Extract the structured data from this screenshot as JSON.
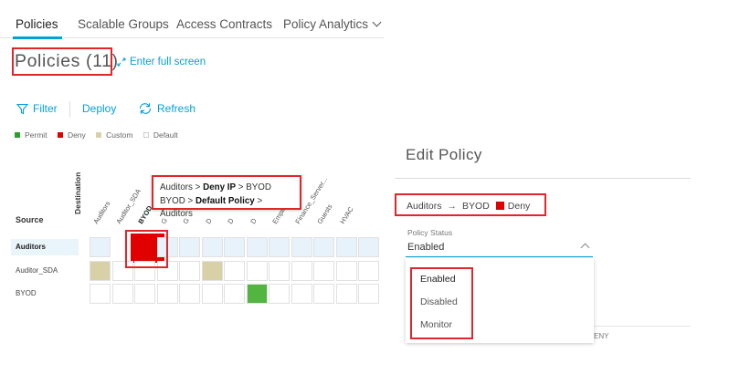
{
  "tabs": [
    {
      "label": "Policies"
    },
    {
      "label": "Scalable Groups"
    },
    {
      "label": "Access Contracts"
    },
    {
      "label": "Policy Analytics"
    }
  ],
  "page_title": "Policies (11)",
  "fullscreen_label": "Enter full screen",
  "toolbar": {
    "filter": "Filter",
    "deploy": "Deploy",
    "refresh": "Refresh"
  },
  "legend": [
    {
      "label": "Permit",
      "color": "#2ca02c"
    },
    {
      "label": "Deny",
      "color": "#e00000"
    },
    {
      "label": "Custom",
      "color": "#d8d0a6"
    },
    {
      "label": "Default",
      "color": "#ffffff"
    }
  ],
  "matrix": {
    "destination_label": "Destination",
    "source_label": "Source",
    "columns": [
      "Auditors",
      "Auditor_SDA",
      "BYOD",
      "G",
      "G",
      "D",
      "D",
      "D",
      "Employees",
      "Finance_Server...",
      "Guests",
      "HVAC"
    ],
    "rows": [
      {
        "label": "Auditors",
        "cells": [
          "default",
          "deny",
          "deny",
          "default",
          "default",
          "default",
          "default",
          "default",
          "default",
          "default",
          "default",
          "default",
          "default"
        ]
      },
      {
        "label": "Auditor_SDA",
        "cells": [
          "custom",
          "default",
          "default",
          "default",
          "default",
          "custom",
          "default",
          "default",
          "default",
          "default",
          "default",
          "default",
          "default"
        ]
      },
      {
        "label": "BYOD",
        "cells": [
          "default",
          "default",
          "default",
          "default",
          "default",
          "default",
          "default",
          "permit",
          "default",
          "default",
          "default",
          "default",
          "default"
        ]
      }
    ],
    "colors": {
      "default": "#ffffff",
      "default_selected": "#e8f2fa",
      "deny": "#e00000",
      "custom": "#d8d0a6",
      "permit": "#52b540"
    }
  },
  "tooltip": {
    "line1": {
      "source": "Auditors",
      "sep1": " > ",
      "contract": "Deny IP",
      "sep2": " > ",
      "dest": "BYOD"
    },
    "line2": {
      "source": "BYOD",
      "sep1": " > ",
      "contract": "Default Policy",
      "sep2": " > ",
      "dest": "Auditors"
    }
  },
  "edit_policy": {
    "title": "Edit Policy",
    "breadcrumb": {
      "source": "Auditors",
      "arrow": "→",
      "dest": "BYOD",
      "contract": "Deny"
    },
    "status_label": "Policy Status",
    "status_value": "Enabled",
    "options": [
      "Enabled",
      "Disabled",
      "Monitor"
    ],
    "partial_text": "ENY"
  },
  "accent_color": "#049fd9",
  "highlight_color": "#e0262b"
}
